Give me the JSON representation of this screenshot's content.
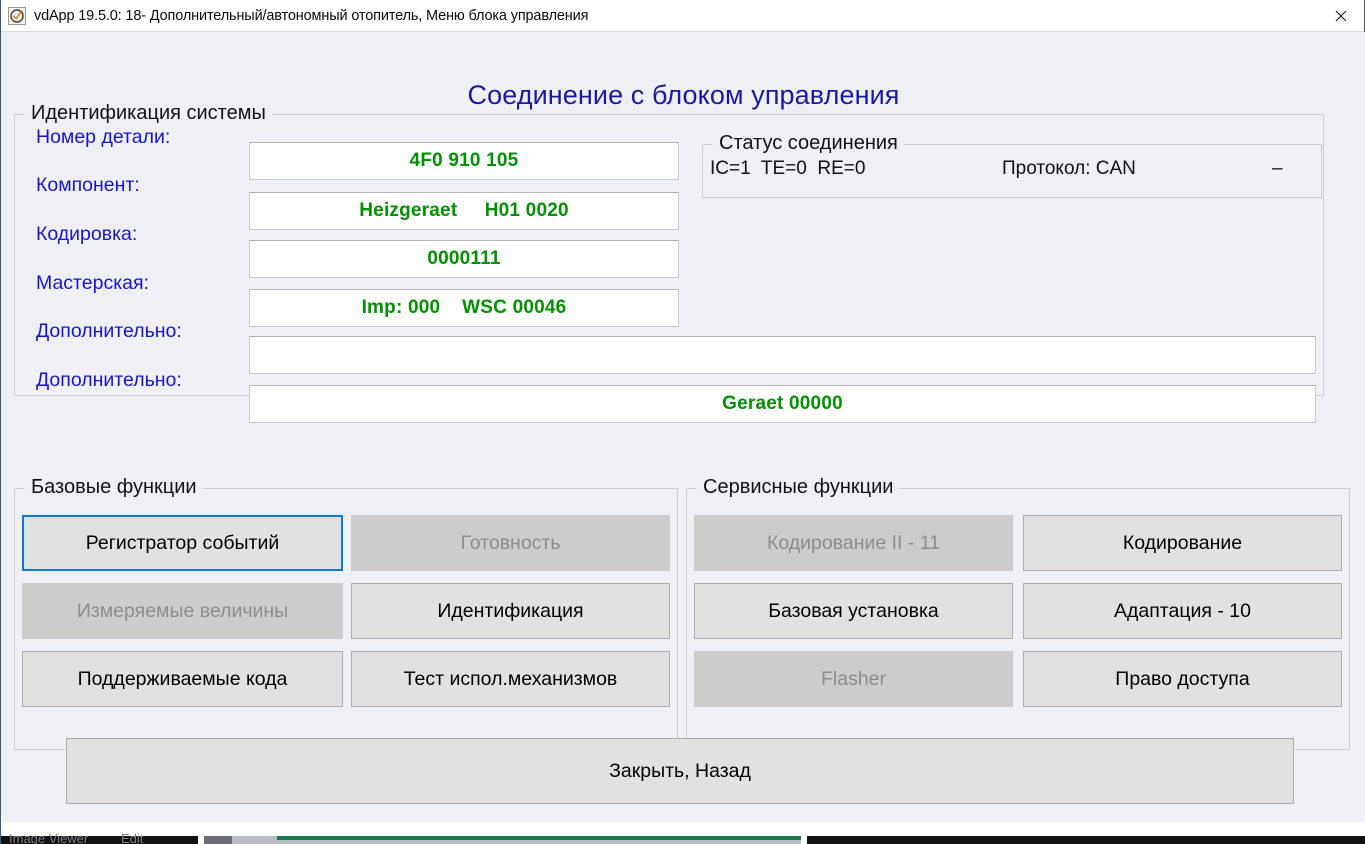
{
  "window": {
    "title": "vdApp 19.5.0: 18- Дополнительный/автономный отопитель,  Меню блока управления",
    "app_icon": "vdapp-logo-icon",
    "close_icon": "close-icon",
    "background_color": "#eff0f5",
    "accent_color": "#1a1a9e"
  },
  "page": {
    "heading": "Соединение с блоком управления"
  },
  "identification": {
    "legend": "Идентификация системы",
    "value_color": "#009000",
    "label_color": "#1616c8",
    "rows": [
      {
        "label": "Номер детали:",
        "value": "4F0 910 105"
      },
      {
        "label": "Компонент:",
        "value": "Heizgeraet     H01 0020"
      },
      {
        "label": "Кодировка:",
        "value": "0000111"
      },
      {
        "label": "Мастерская:",
        "value": "Imp: 000    WSC 00046"
      },
      {
        "label": "Дополнительно:",
        "value": ""
      },
      {
        "label": "Дополнительно:",
        "value": "Geraet 00000"
      }
    ]
  },
  "connection_status": {
    "legend": "Статус соединения",
    "counters": "IC=1  TE=0  RE=0",
    "protocol": "Протокол: CAN",
    "extra": "–"
  },
  "basic_functions": {
    "legend": "Базовые функции",
    "buttons": [
      {
        "label": "Регистратор событий",
        "state": "focused"
      },
      {
        "label": "Готовность",
        "state": "disabled"
      },
      {
        "label": "Измеряемые величины",
        "state": "disabled"
      },
      {
        "label": "Идентификация",
        "state": "enabled"
      },
      {
        "label": "Поддерживаемые кода",
        "state": "enabled"
      },
      {
        "label": "Тест испол.механизмов",
        "state": "enabled"
      }
    ]
  },
  "service_functions": {
    "legend": "Сервисные функции",
    "buttons": [
      {
        "label": "Кодирование II - 11",
        "state": "disabled"
      },
      {
        "label": "Кодирование",
        "state": "enabled"
      },
      {
        "label": "Базовая установка",
        "state": "enabled"
      },
      {
        "label": "Адаптация - 10",
        "state": "enabled"
      },
      {
        "label": "Flasher",
        "state": "disabled"
      },
      {
        "label": "Право доступа",
        "state": "enabled"
      }
    ]
  },
  "footer": {
    "close_button": "Закрыть, Назад"
  },
  "taskbar": {
    "item_one": "Image Viewer",
    "item_two": "Edit"
  }
}
